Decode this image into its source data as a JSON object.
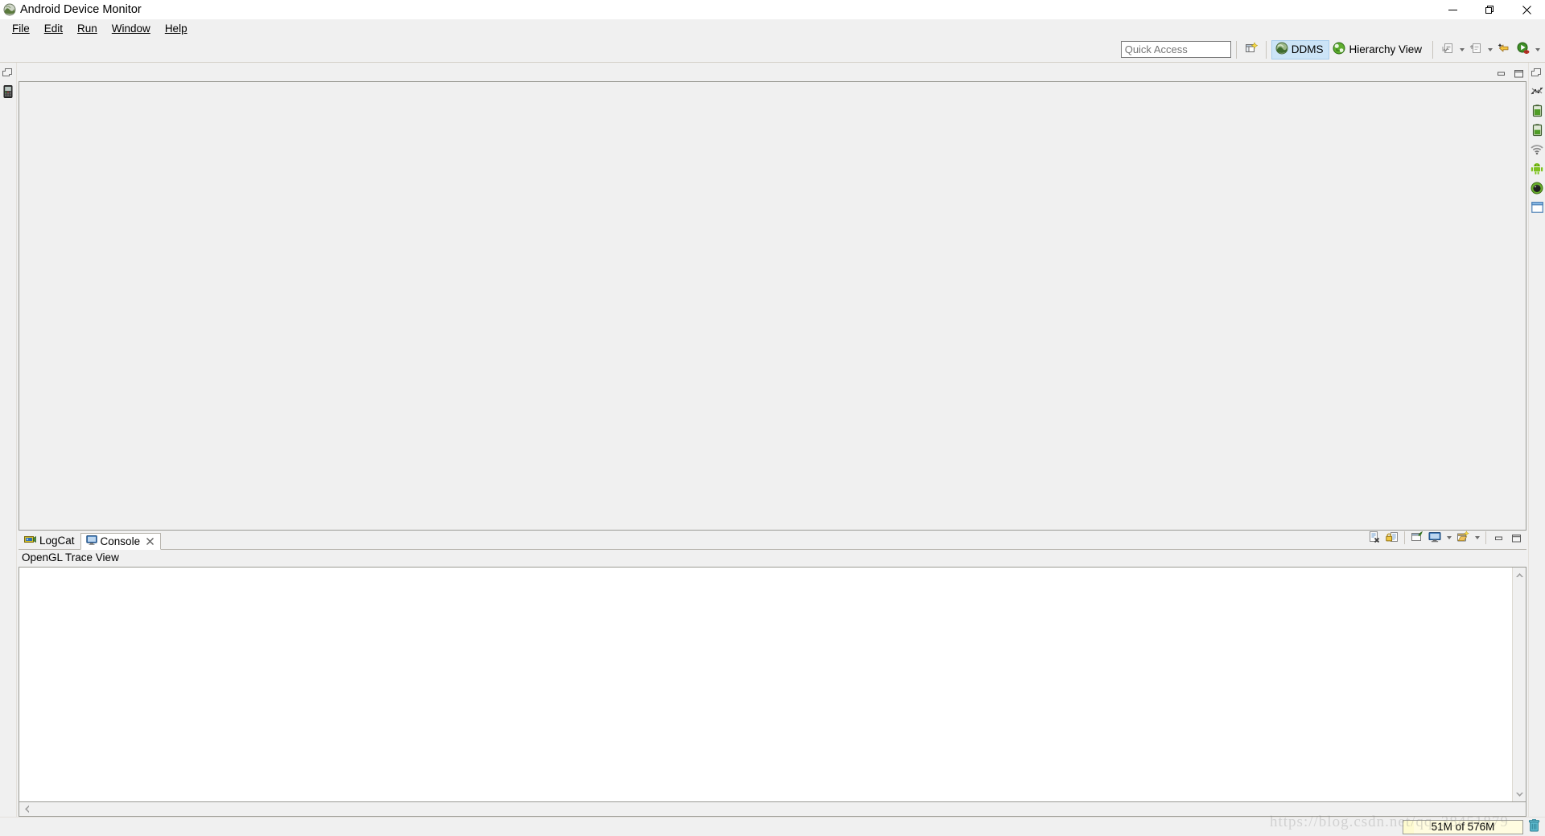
{
  "window": {
    "title": "Android Device Monitor",
    "app_icon": "android-monitor-icon",
    "controls": {
      "minimize": "Minimize",
      "restore": "Restore",
      "close": "Close"
    }
  },
  "menubar": {
    "items": [
      {
        "label": "File",
        "mnemonic": "F"
      },
      {
        "label": "Edit",
        "mnemonic": "E"
      },
      {
        "label": "Run",
        "mnemonic": "R"
      },
      {
        "label": "Window",
        "mnemonic": "W"
      },
      {
        "label": "Help",
        "mnemonic": "H"
      }
    ]
  },
  "toolbar": {
    "quick_access": {
      "value": "",
      "placeholder": "Quick Access"
    },
    "open_perspective_label": "Open Perspective",
    "perspectives": [
      {
        "label": "DDMS",
        "icon": "ddms-icon",
        "active": true
      },
      {
        "label": "Hierarchy View",
        "icon": "hierarchy-view-icon",
        "active": false
      }
    ],
    "actions": [
      {
        "name": "dump-hprof-file",
        "label": "Dump HPROF File",
        "has_dropdown": true
      },
      {
        "name": "update-heap",
        "label": "Update Heap",
        "has_dropdown": true
      },
      {
        "name": "cause-gc",
        "label": "Cause GC",
        "has_dropdown": false
      },
      {
        "name": "debug-process",
        "label": "Debug Process",
        "has_dropdown": true
      }
    ]
  },
  "left_fast_view": {
    "items": [
      {
        "name": "restore-trim-part",
        "label": "Restore"
      },
      {
        "name": "devices-view",
        "label": "Devices",
        "icon": "devices-icon"
      }
    ]
  },
  "right_fast_view": {
    "items": [
      {
        "name": "restore-trim-part",
        "label": "Restore"
      },
      {
        "name": "threads-view",
        "label": "Threads",
        "icon": "threads-icon"
      },
      {
        "name": "heap-view",
        "label": "Heap",
        "icon": "heap-icon"
      },
      {
        "name": "allocation-tracker-view",
        "label": "Allocation Tracker",
        "icon": "allocation-tracker-icon"
      },
      {
        "name": "network-statistics-view",
        "label": "Network Statistics",
        "icon": "network-statistics-icon"
      },
      {
        "name": "file-explorer-view",
        "label": "File Explorer",
        "icon": "file-explorer-icon"
      },
      {
        "name": "emulator-control-view",
        "label": "Emulator Control",
        "icon": "emulator-control-icon"
      },
      {
        "name": "system-information-view",
        "label": "System Information",
        "icon": "system-information-icon"
      }
    ]
  },
  "editor_area": {
    "content": "",
    "controls": {
      "minimize": "Minimize",
      "maximize": "Maximize"
    }
  },
  "bottom_panel": {
    "tabs": [
      {
        "label": "LogCat",
        "icon": "logcat-icon",
        "active": false,
        "closable": false
      },
      {
        "label": "Console",
        "icon": "console-icon",
        "active": true,
        "closable": true
      }
    ],
    "console_title": "OpenGL Trace View",
    "console_content": "",
    "toolbar": [
      {
        "name": "clear-console",
        "label": "Clear Console",
        "has_dropdown": false
      },
      {
        "name": "scroll-lock",
        "label": "Scroll Lock",
        "has_dropdown": false
      },
      {
        "name": "pin-console",
        "label": "Pin Console",
        "has_dropdown": false
      },
      {
        "name": "display-selected-console",
        "label": "Display Selected Console",
        "has_dropdown": true
      },
      {
        "name": "open-console",
        "label": "Open Console",
        "has_dropdown": true
      }
    ],
    "controls": {
      "minimize": "Minimize",
      "maximize": "Maximize"
    },
    "scrollbars": {
      "vertical_up": "Scroll Up",
      "vertical_down": "Scroll Down",
      "horizontal_left": "Scroll Left",
      "horizontal_right": "Scroll Right"
    }
  },
  "statusbar": {
    "heap_status": "51M of 576M",
    "heap_used_percent": 9,
    "gc_button_label": "Run Garbage Collector"
  },
  "watermark": {
    "text": "https://blog.csdn.net/qq_38451879"
  },
  "colors": {
    "window_bg": "#f0f0f0",
    "panel_border": "#9a9a94",
    "active_perspective_bg": "#cce4f7",
    "active_perspective_border": "#a9cdeb",
    "console_bg": "#ffffff",
    "heap_bar_bg": "#fffce0",
    "accent_green": "#4f9d26"
  }
}
